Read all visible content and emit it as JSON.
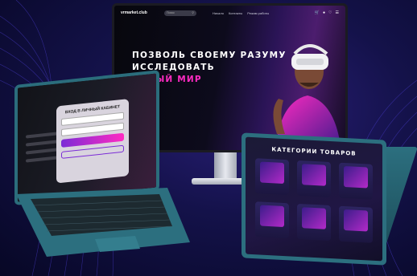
{
  "website": {
    "logo": "vrmarket.club",
    "search_placeholder": "Поиск",
    "nav_links": [
      "Начало",
      "Контакты",
      "Режим работы"
    ],
    "hero": {
      "line1": "ПОЗВОЛЬ СВОЕМУ РАЗУМУ",
      "line2": "ИССЛЕДОВАТЬ",
      "line3": "НОВЫЙ МИР"
    }
  },
  "login_modal": {
    "title": "ВХОД В ЛИЧНЫЙ КАБИНЕТ"
  },
  "tablet": {
    "title": "КАТЕГОРИИ ТОВАРОВ",
    "categories": [
      "",
      "",
      "",
      "",
      "",
      ""
    ]
  },
  "colors": {
    "accent_pink": "#ff2bc2",
    "accent_purple": "#7b2bd6",
    "device_teal": "#2c6f7f",
    "background": "#14124a"
  }
}
